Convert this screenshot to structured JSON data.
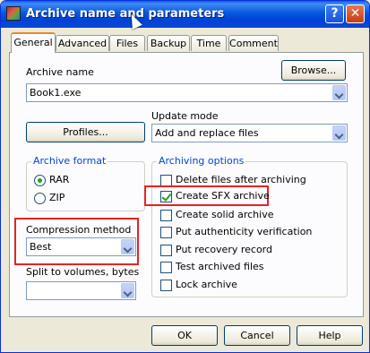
{
  "window": {
    "title": "Archive name and parameters",
    "help_glyph": "?",
    "close_glyph": "✕"
  },
  "tabs": [
    "General",
    "Advanced",
    "Files",
    "Backup",
    "Time",
    "Comment"
  ],
  "general": {
    "archive_name_label": "Archive name",
    "browse_label": "Browse...",
    "archive_name_value": "Book1.exe",
    "profiles_label": "Profiles...",
    "update_mode_label": "Update mode",
    "update_mode_value": "Add and replace files",
    "archive_format": {
      "legend": "Archive format",
      "options": [
        "RAR",
        "ZIP"
      ],
      "selected": "RAR"
    },
    "compression_label": "Compression method",
    "compression_value": "Best",
    "split_label": "Split to volumes, bytes",
    "split_value": "",
    "archiving_options": {
      "legend": "Archiving options",
      "items": [
        {
          "label": "Delete files after archiving",
          "checked": false
        },
        {
          "label": "Create SFX archive",
          "checked": true
        },
        {
          "label": "Create solid archive",
          "checked": false
        },
        {
          "label": "Put authenticity verification",
          "checked": false
        },
        {
          "label": "Put recovery record",
          "checked": false
        },
        {
          "label": "Test archived files",
          "checked": false
        },
        {
          "label": "Lock archive",
          "checked": false
        }
      ]
    }
  },
  "footer": {
    "ok": "OK",
    "cancel": "Cancel",
    "help": "Help"
  },
  "colors": {
    "highlight": "#e32424",
    "titlebar": "#0a5ae8"
  }
}
